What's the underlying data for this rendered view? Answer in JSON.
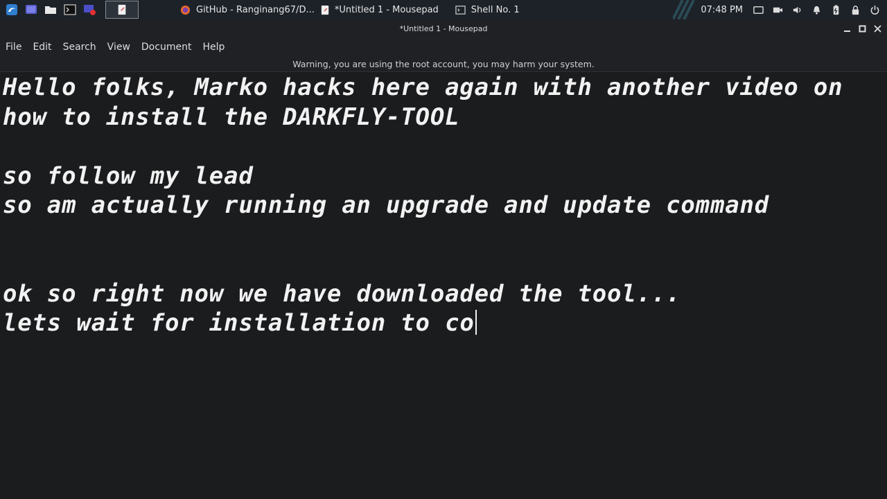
{
  "taskbar": {
    "tasks": [
      {
        "label": "GitHub - Ranginang67/D...",
        "icon": "firefox-icon"
      },
      {
        "label": "*Untitled 1 - Mousepad",
        "icon": "mousepad-icon"
      },
      {
        "label": "Shell No. 1",
        "icon": "terminal-icon"
      }
    ],
    "clock": "07:48 PM"
  },
  "window": {
    "title": "*Untitled 1 - Mousepad"
  },
  "menubar": {
    "items": [
      "File",
      "Edit",
      "Search",
      "View",
      "Document",
      "Help"
    ]
  },
  "warning": "Warning, you are using the root account, you may harm your system.",
  "editor": {
    "lines": [
      "Hello folks, Marko hacks here again with another video on",
      "how to install the DARKFLY-TOOL",
      "",
      "so follow my lead",
      "so am actually running an upgrade and update command",
      "",
      "",
      "ok so right now we have downloaded the tool...",
      "lets wait for installation to co"
    ]
  },
  "colors": {
    "panel_bg": "#1d2229",
    "window_bg": "#1f2125",
    "editor_bg": "#1b1c1e",
    "text": "#f2f2f2",
    "kali_blue": "#3f8fd8"
  }
}
